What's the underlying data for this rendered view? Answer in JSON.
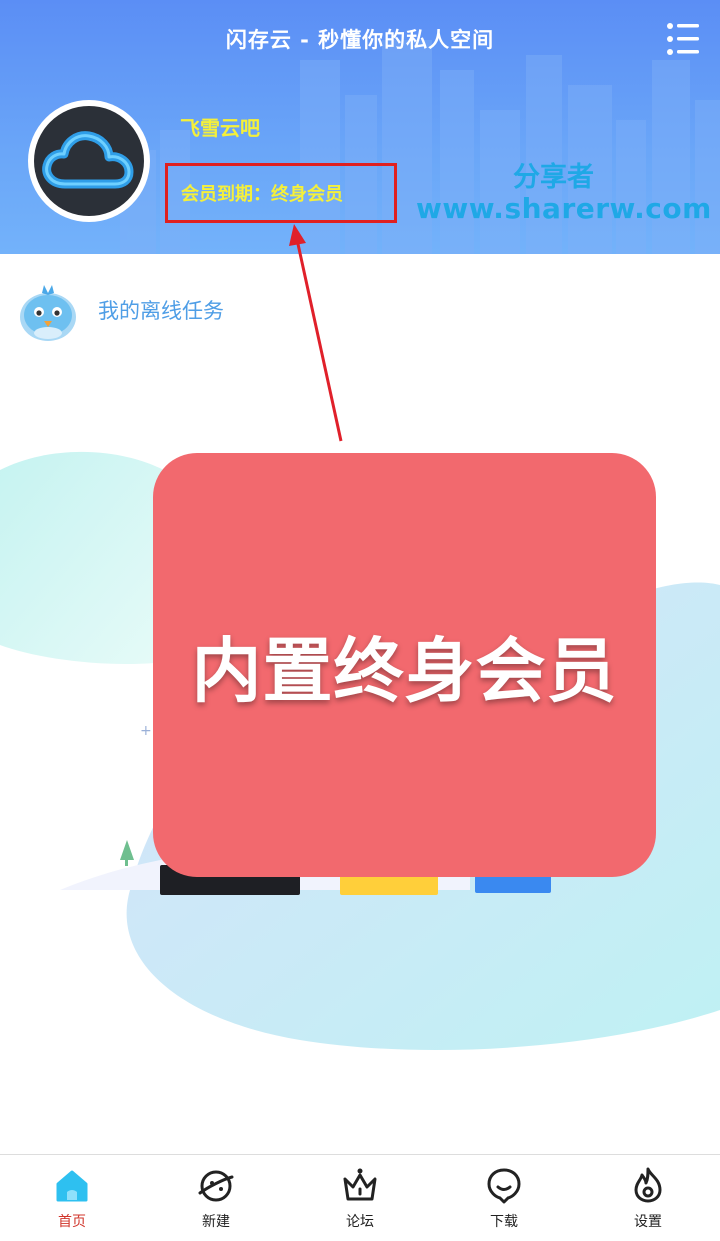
{
  "header": {
    "title": "闪存云 - 秒懂你的私人空间",
    "menu_icon": "list-menu-icon",
    "username": "飞雪云吧",
    "member_status": "会员到期：终身会员",
    "watermark_name": "分享者",
    "watermark_url": "www.sharerw.com"
  },
  "offline_task": {
    "label": "我的离线任务",
    "icon": "bird-icon"
  },
  "overlay": {
    "text": "内置终身会员"
  },
  "bottom_nav": {
    "items": [
      {
        "label": "首页",
        "icon": "home-icon",
        "active": true
      },
      {
        "label": "新建",
        "icon": "planet-icon",
        "active": false
      },
      {
        "label": "论坛",
        "icon": "crown-icon",
        "active": false
      },
      {
        "label": "下载",
        "icon": "download-face-icon",
        "active": false
      },
      {
        "label": "设置",
        "icon": "flame-settings-icon",
        "active": false
      }
    ]
  },
  "colors": {
    "header_blue": "#5b8ef5",
    "accent_yellow": "#f5f03a",
    "highlight_red": "#e02020",
    "overlay_red": "#f2696e",
    "watermark_blue": "#1fa8e6",
    "nav_active": "#d0352b"
  }
}
